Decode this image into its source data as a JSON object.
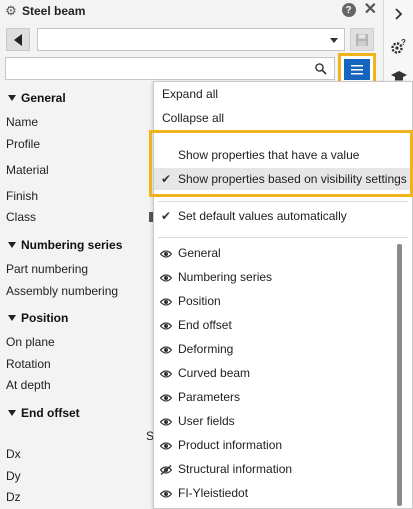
{
  "window": {
    "title": "Steel beam"
  },
  "props": {
    "groups": [
      {
        "label": "General",
        "items": [
          "Name",
          "Profile",
          "Material",
          "Finish",
          "Class"
        ]
      },
      {
        "label": "Numbering series",
        "items": [
          "Part numbering",
          "Assembly numbering"
        ]
      },
      {
        "label": "Position",
        "items": [
          "On plane",
          "Rotation",
          "At depth"
        ]
      },
      {
        "label": "End offset",
        "items": [
          "Dx",
          "Dy",
          "Dz"
        ]
      }
    ],
    "truncated_s": "S"
  },
  "menu": {
    "expand_all": "Expand all",
    "collapse_all": "Collapse all",
    "show_with_value": "Show properties that have a value",
    "show_visibility": "Show properties based on visibility settings",
    "set_default": "Set default values automatically",
    "sections": [
      {
        "label": "General",
        "icon": "eye-icon"
      },
      {
        "label": "Numbering series",
        "icon": "eye-icon"
      },
      {
        "label": "Position",
        "icon": "eye-icon"
      },
      {
        "label": "End offset",
        "icon": "eye-icon"
      },
      {
        "label": "Deforming",
        "icon": "eye-icon"
      },
      {
        "label": "Curved beam",
        "icon": "eye-icon"
      },
      {
        "label": "Parameters",
        "icon": "eye-icon"
      },
      {
        "label": "User fields",
        "icon": "eye-icon"
      },
      {
        "label": "Product information",
        "icon": "eye-icon"
      },
      {
        "label": "Structural information",
        "icon": "eye-slash-icon"
      },
      {
        "label": "FI-Yleistiedot",
        "icon": "eye-icon"
      }
    ]
  },
  "colors": {
    "accent": "#1565c0",
    "highlight": "#f0b31c"
  }
}
